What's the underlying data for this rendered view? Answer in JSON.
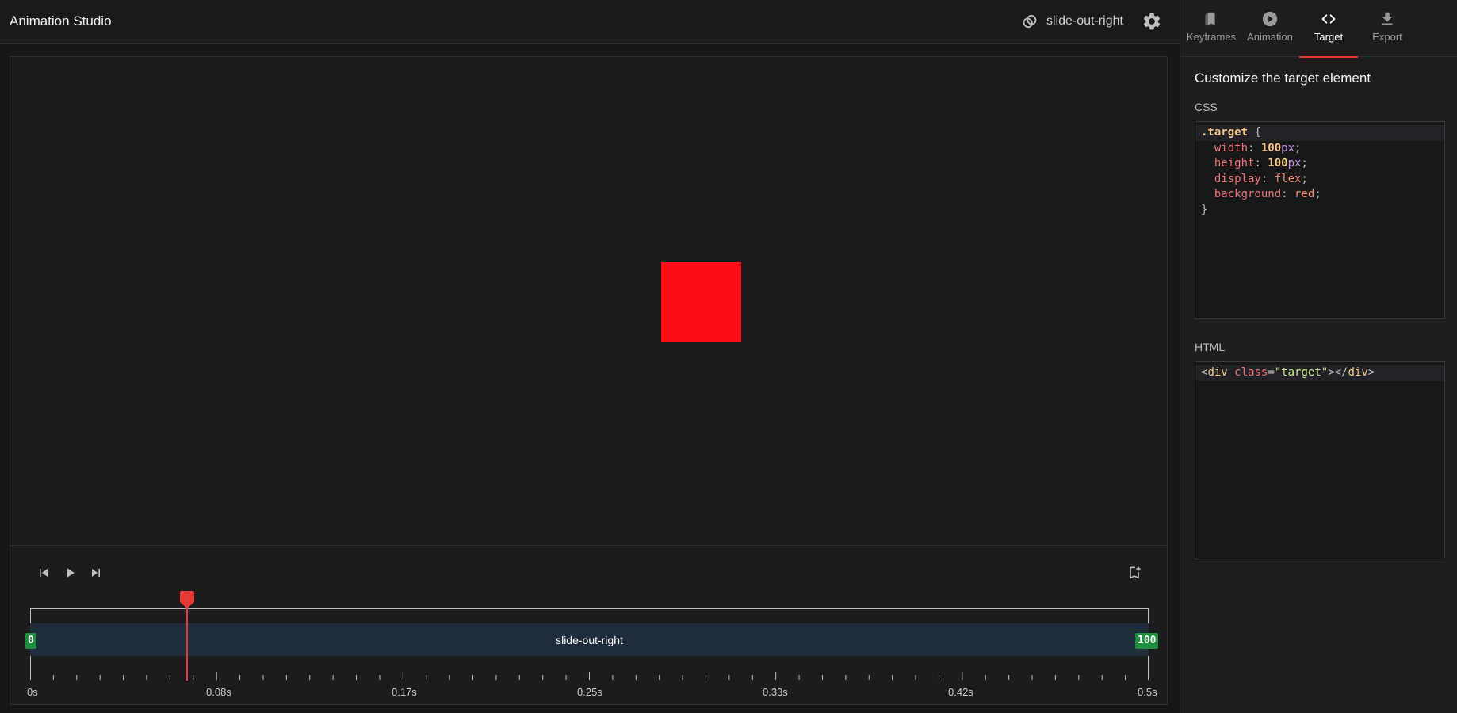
{
  "header": {
    "title": "Animation Studio",
    "animation_name": "slide-out-right"
  },
  "tabs": [
    {
      "label": "Keyframes",
      "icon": "bookmark-icon",
      "active": false
    },
    {
      "label": "Animation",
      "icon": "play-circle-icon",
      "active": false
    },
    {
      "label": "Target",
      "icon": "code-icon",
      "active": true
    },
    {
      "label": "Export",
      "icon": "download-icon",
      "active": false
    }
  ],
  "panel": {
    "heading": "Customize the target element",
    "css_label": "CSS",
    "html_label": "HTML"
  },
  "css_code": {
    "selector": ".target",
    "props": [
      {
        "name": "width",
        "num": "100",
        "unit": "px"
      },
      {
        "name": "height",
        "num": "100",
        "unit": "px"
      },
      {
        "name": "display",
        "value": "flex"
      },
      {
        "name": "background",
        "value": "red"
      }
    ]
  },
  "html_code": {
    "tag": "div",
    "attr": "class",
    "attr_value": "\"target\""
  },
  "preview": {
    "target_color": "#ff0d14"
  },
  "timeline": {
    "track_label": "slide-out-right",
    "start_keyframe": "0",
    "end_keyframe": "100",
    "tick_labels": [
      "0s",
      "0.08s",
      "0.17s",
      "0.25s",
      "0.33s",
      "0.42s",
      "0.5s"
    ],
    "duration_s": 0.5,
    "playhead_s": 0.07
  },
  "colors": {
    "accent": "#e53935",
    "keyframe": "#1e8e3e",
    "track": "#1f2d3d"
  }
}
